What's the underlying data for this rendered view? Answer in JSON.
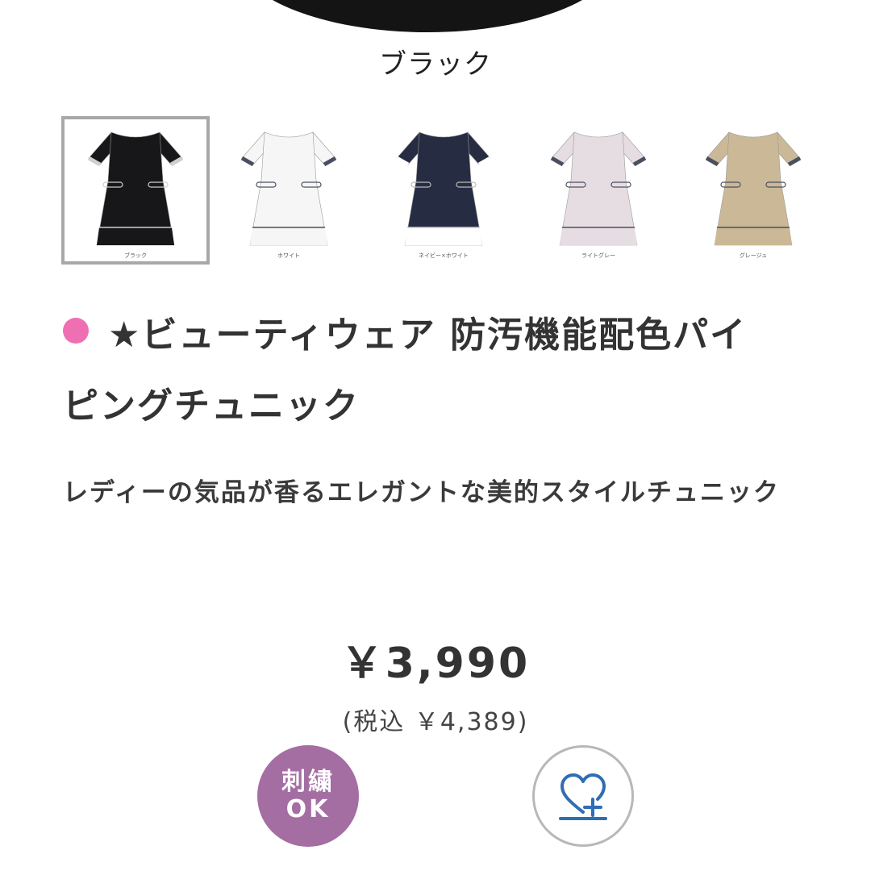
{
  "hero": {
    "color_name": "ブラック"
  },
  "thumbnails": [
    {
      "label": "ブラック",
      "body": "#17171a",
      "trim": "#cfcfcf",
      "panel": "#17171a",
      "selected": true
    },
    {
      "label": "ホワイト",
      "body": "#f6f6f6",
      "trim": "#4a4f5f",
      "panel": "#f6f6f6",
      "selected": false
    },
    {
      "label": "ネイビー×ホワイト",
      "body": "#262d43",
      "trim": "#ffffff",
      "panel": "#ffffff",
      "selected": false
    },
    {
      "label": "ライトグレー",
      "body": "#e6dde3",
      "trim": "#4a4f5f",
      "panel": "#e6dde3",
      "selected": false
    },
    {
      "label": "グレージュ",
      "body": "#cbb896",
      "trim": "#4a4f5f",
      "panel": "#cbb896",
      "selected": false
    }
  ],
  "product": {
    "title_line1": "★ビューティウェア 防汚機能配色パイ",
    "title_line2": "ピングチュニック",
    "subtitle": "レディーの気品が香るエレガントな美的スタイルチュニック",
    "price": "￥3,990",
    "price_tax": "(税込 ￥4,389)"
  },
  "badges": {
    "embroidery_line1": "刺繍",
    "embroidery_line2": "OK"
  },
  "colors": {
    "title_dot": "#ee6fb2",
    "embroidery_badge": "#a46ea3",
    "favorite_icon": "#2f6db4"
  },
  "icons": {
    "favorite": "heart-plus-icon"
  }
}
